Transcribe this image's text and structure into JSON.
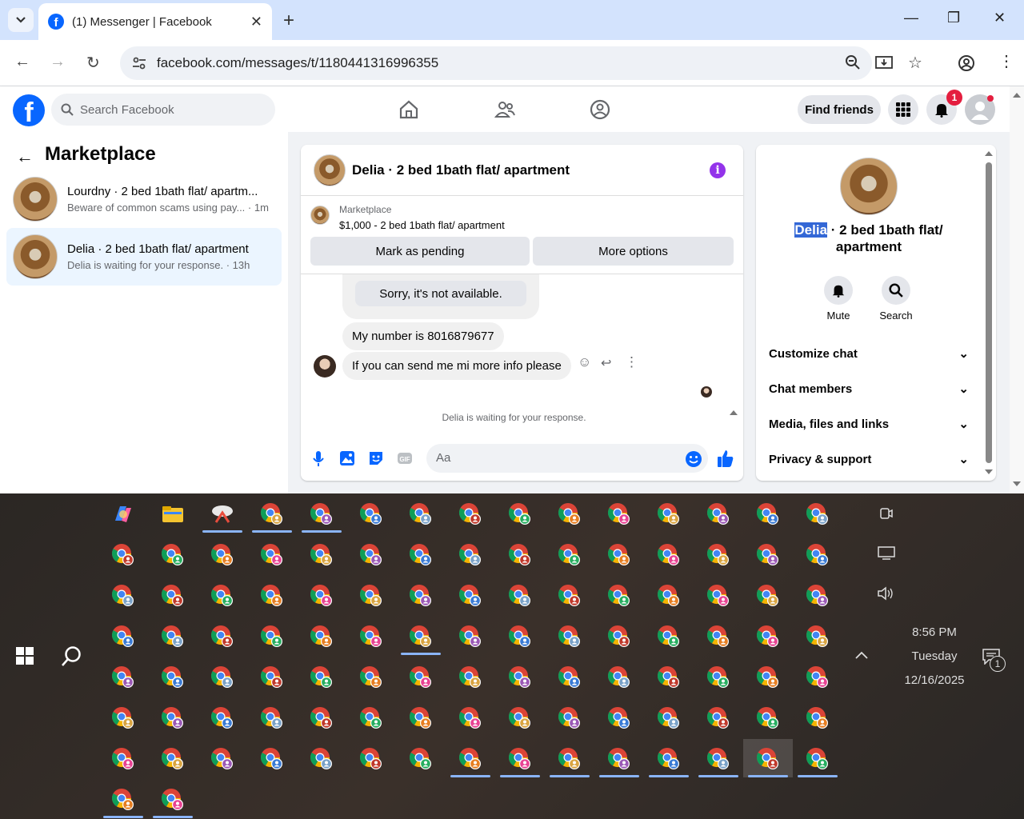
{
  "browser": {
    "tab_title": "(1) Messenger | Facebook",
    "url": "facebook.com/messages/t/1180441316996355"
  },
  "fb": {
    "search_placeholder": "Search Facebook",
    "find_friends": "Find friends",
    "notif_count": "1"
  },
  "left": {
    "title": "Marketplace",
    "conversations": [
      {
        "name": "Lourdny · 2 bed 1bath flat/ apartm...",
        "preview": "Beware of common scams using pay... · 1m"
      },
      {
        "name": "Delia · 2 bed 1bath flat/ apartment",
        "preview": "Delia is waiting for your response. · 13h"
      }
    ]
  },
  "chat": {
    "header": "Delia · 2 bed 1bath flat/ apartment",
    "marketplace_label": "Marketplace",
    "listing": "$1,000 - 2 bed 1bath flat/ apartment",
    "mark_pending": "Mark as pending",
    "more_options": "More options",
    "quoted": "Sorry, it's not available.",
    "messages": [
      "My number is 8016879677",
      "If you can send me mi more info please"
    ],
    "waiting": "Delia is waiting for your response.",
    "input_placeholder": "Aa"
  },
  "right": {
    "name_highlight": "Delia",
    "name_rest": " · 2 bed 1bath flat/ apartment",
    "mute": "Mute",
    "search": "Search",
    "sections": [
      "Customize chat",
      "Chat members",
      "Media, files and links",
      "Privacy & support"
    ]
  },
  "taskbar": {
    "time": "8:56 PM",
    "day": "Tuesday",
    "date": "12/16/2025",
    "notif_count": "1"
  },
  "colors": {
    "fb_blue": "#0866ff",
    "accent_purple": "#9333ea",
    "badge_red": "#e41e3f"
  }
}
